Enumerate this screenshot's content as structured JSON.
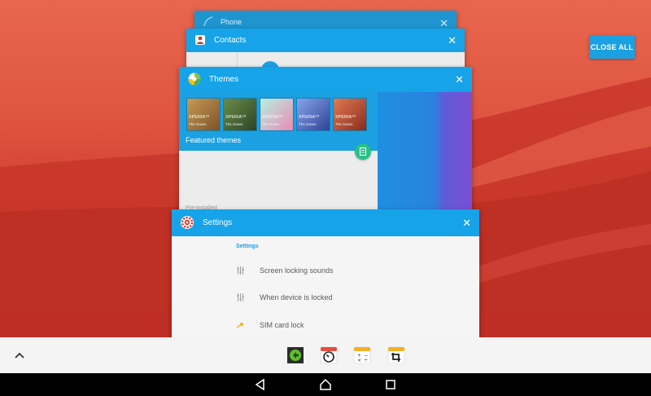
{
  "recents": {
    "close_all_label": "CLOSE ALL",
    "cards": {
      "phone": {
        "title": "Phone"
      },
      "contacts": {
        "title": "Contacts"
      },
      "themes": {
        "title": "Themes",
        "tiles": [
          {
            "brand": "XPERIA™",
            "subtitle": "The Green",
            "color": "#a0763c"
          },
          {
            "brand": "XPERIA™",
            "subtitle": "The Green",
            "color": "#4b6b3a"
          },
          {
            "brand": "XPERIA™",
            "subtitle": "The Green",
            "color": "#8ed1c4"
          },
          {
            "brand": "XPERIA™",
            "subtitle": "The Green",
            "color": "#5e77c2"
          },
          {
            "brand": "XPERIA™",
            "subtitle": "The Green",
            "color": "#c0583d"
          }
        ],
        "featured_label": "Featured themes",
        "preinstalled_label": "Pre-installed"
      },
      "settings": {
        "title": "Settings",
        "section_label": "Settings",
        "rows": [
          {
            "icon": "sliders-icon",
            "label": "Screen locking sounds"
          },
          {
            "icon": "sliders-icon",
            "label": "When device is locked"
          },
          {
            "icon": "key-icon",
            "label": "SIM card lock"
          }
        ]
      }
    }
  },
  "dock": {
    "apps": [
      "games-app-icon",
      "clock-timer-app-icon",
      "calculator-app-icon",
      "crop-app-icon"
    ]
  },
  "navbar": {
    "buttons": [
      "back-button",
      "home-button",
      "recents-button"
    ]
  },
  "colors": {
    "accent": "#1ba1e2",
    "wallpaper": "#d23f30",
    "fab_green": "#27c08a"
  }
}
